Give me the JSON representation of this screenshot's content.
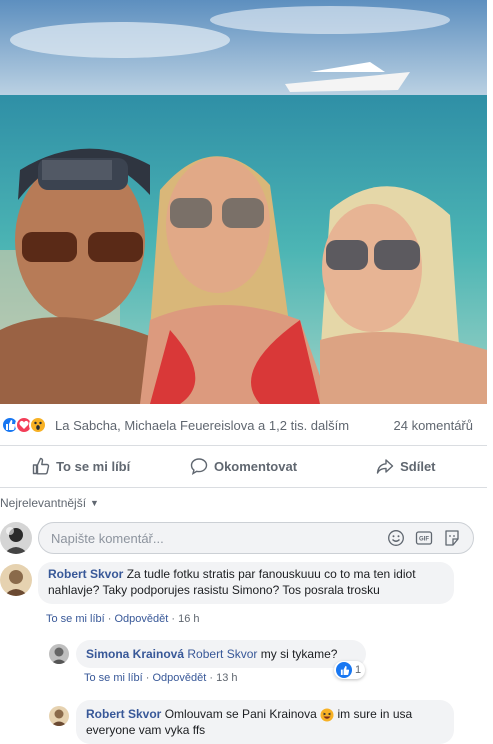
{
  "post": {
    "reactions": {
      "icons": [
        "like-icon",
        "love-icon",
        "wow-icon"
      ],
      "names": "La Sabcha, Michaela Feuereislova a 1,2 tis. dalším",
      "comment_count": "24 komentářů"
    },
    "actions": {
      "like": "To se mi líbí",
      "comment": "Okomentovat",
      "share": "Sdílet"
    }
  },
  "comments_section": {
    "sort_label": "Nejrelevantnější",
    "composer_placeholder": "Napište komentář...",
    "composer_icons": [
      "emoji-icon",
      "gif-icon",
      "sticker-icon"
    ],
    "comments": [
      {
        "author": "Robert Skvor",
        "text": "Za tudle fotku stratis par fanouskuuu co to ma ten idiot nahlavje? Taky podporujes rasistu Simono? Tos posrala trosku",
        "like": "To se mi líbí",
        "reply": "Odpovědět",
        "time": "16 h"
      },
      {
        "author": "Simona Krainová",
        "mention": "Robert Skvor",
        "text": "my si tykame?",
        "like": "To se mi líbí",
        "reply": "Odpovědět",
        "time": "13 h",
        "reaction_count": "1"
      },
      {
        "author": "Robert Skvor",
        "text_before": "Omlouvam se Pani Krainova",
        "text_after": "im sure in usa everyone vam vyka ffs"
      }
    ]
  },
  "colors": {
    "link": "#385898",
    "muted": "#606770",
    "bubble": "#f2f3f5",
    "like_blue": "#1877f2",
    "love_red": "#f33e58",
    "wow_yellow": "#f7b125"
  }
}
